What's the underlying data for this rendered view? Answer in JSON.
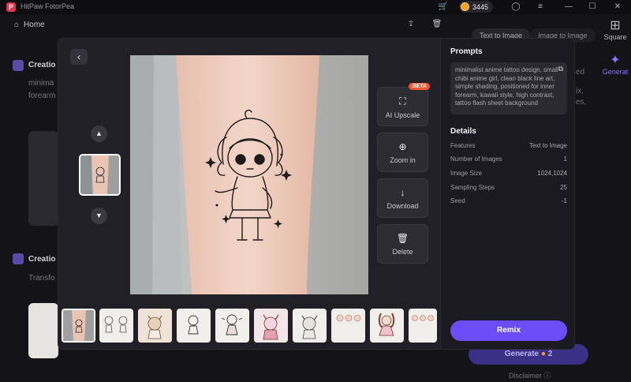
{
  "app": {
    "title": "HitPaw FotorPea",
    "coins": "3445"
  },
  "nav": {
    "home": "Home"
  },
  "background": {
    "creation_1_title": "Creatio",
    "creation_1_line1": "minima",
    "creation_1_line2": "forearm",
    "creation_2_title": "Creatio",
    "creation_2_line1": "Transfo",
    "tab_text_to_image": "Text to Image",
    "tab_image_to_image": "Image to Image",
    "side_square": "Square",
    "side_generate": "Generat",
    "right_frag_1": "ed",
    "right_frag_2": "ix,",
    "right_frag_3": "es,",
    "generate_label": "Generate",
    "generate_cost": "2",
    "disclaimer": "Disclaimer"
  },
  "modal": {
    "tools": [
      {
        "label": "AI Upscale",
        "icon": "upscale-icon",
        "badge": "BETA"
      },
      {
        "label": "Zoom in",
        "icon": "zoom-in-icon"
      },
      {
        "label": "Download",
        "icon": "download-icon"
      },
      {
        "label": "Delete",
        "icon": "trash-icon"
      }
    ],
    "prompts_title": "Prompts",
    "prompt_text": "minimalist anime tattoo design, small chibi anime girl, clean black line art, simple shading, positioned for inner forearm, kawaii style, high contrast, tattoo flash sheet background",
    "details_title": "Details",
    "details": [
      {
        "label": "Features",
        "value": "Text to Image"
      },
      {
        "label": "Number of Images",
        "value": "1"
      },
      {
        "label": "Image Size",
        "value": "1024,1024"
      },
      {
        "label": "Sampling Steps",
        "value": "25"
      },
      {
        "label": "Seed",
        "value": "-1"
      }
    ],
    "remix_label": "Remix"
  },
  "colors": {
    "accent": "#6c4df5",
    "beta_badge": "#f3552f",
    "modal_bg": "#202026"
  }
}
